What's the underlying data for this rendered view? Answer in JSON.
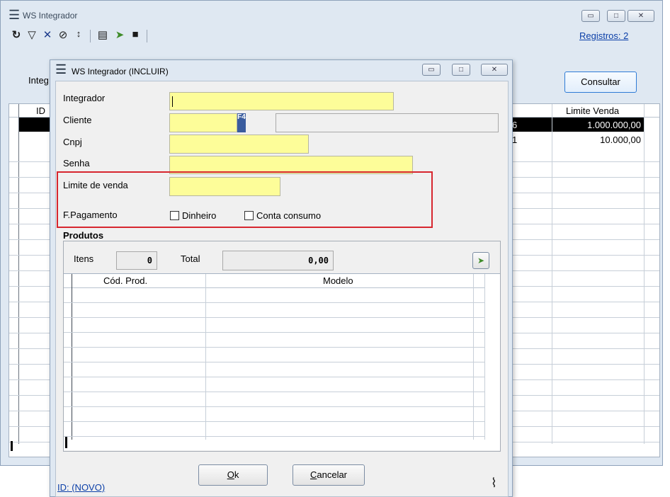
{
  "main_window": {
    "title": "WS Integrador",
    "registros": "Registros: 2",
    "integrador_label_partial": "Integ",
    "consultar_label": "Consultar",
    "grid": {
      "col_id": "ID",
      "col_limite": "Limite Venda",
      "rows": [
        {
          "mid": "6",
          "limite": "1.000.000,00",
          "selected": true
        },
        {
          "mid": "1",
          "limite": "10.000,00",
          "selected": false
        }
      ]
    }
  },
  "dialog": {
    "title": "WS Integrador (INCLUIR)",
    "fields": {
      "integrador_label": "Integrador",
      "integrador_value": "",
      "cliente_label": "Cliente",
      "cliente_value": "",
      "cliente_desc": "",
      "f4_label": "F4",
      "cnpj_label": "Cnpj",
      "cnpj_value": "",
      "senha_label": "Senha",
      "senha_value": "",
      "limite_label": "Limite de venda",
      "limite_value": ""
    },
    "pagamento": {
      "label": "F.Pagamento",
      "opt_dinheiro": "Dinheiro",
      "opt_conta": "Conta consumo"
    },
    "produtos": {
      "title": "Produtos",
      "itens_label": "Itens",
      "itens_value": "0",
      "total_label": "Total",
      "total_value": "0,00",
      "col_codigo": "Cód. Prod.",
      "col_modelo": "Modelo"
    },
    "ok_label": "Ok",
    "cancelar_label": "Cancelar",
    "id_label": "ID: (NOVO)"
  },
  "icons": [
    "menu-icon",
    "refresh-icon",
    "filter-icon",
    "clear-filter-icon",
    "find-icon",
    "sort-icon",
    "print-icon",
    "export-icon",
    "save-icon",
    "attach-icon"
  ]
}
